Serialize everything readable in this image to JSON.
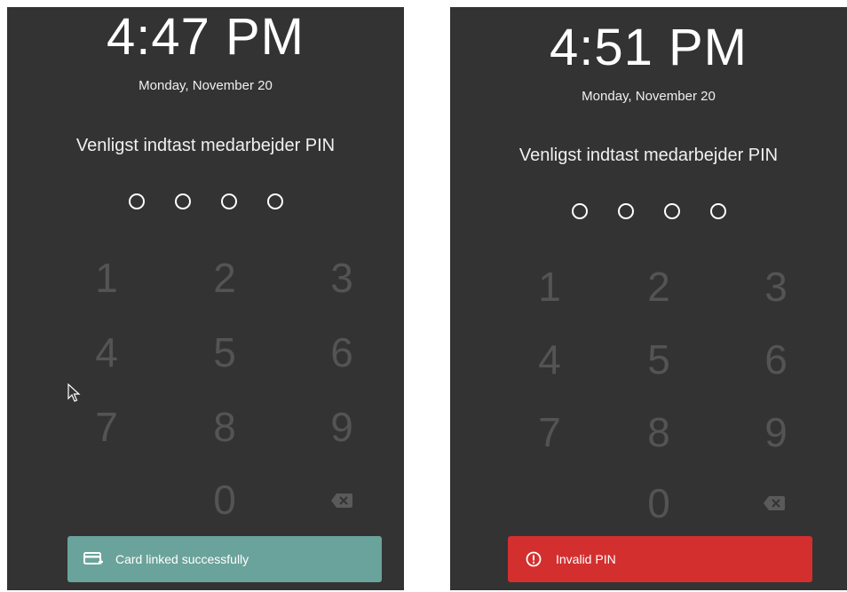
{
  "left": {
    "time": "4:47 PM",
    "date": "Monday, November 20",
    "prompt": "Venligst indtast medarbejder PIN",
    "keys": [
      "1",
      "2",
      "3",
      "4",
      "5",
      "6",
      "7",
      "8",
      "9",
      "0"
    ],
    "toast": {
      "text": "Card linked successfully",
      "icon": "card-add-icon",
      "color": "#6aa39b"
    }
  },
  "right": {
    "time": "4:51 PM",
    "date": "Monday, November 20",
    "prompt": "Venligst indtast medarbejder PIN",
    "keys": [
      "1",
      "2",
      "3",
      "4",
      "5",
      "6",
      "7",
      "8",
      "9",
      "0"
    ],
    "toast": {
      "text": "Invalid PIN",
      "icon": "error-circle-icon",
      "color": "#d32f2f"
    }
  },
  "colors": {
    "background": "#333333",
    "digit": "#545454",
    "text": "#ffffff"
  }
}
